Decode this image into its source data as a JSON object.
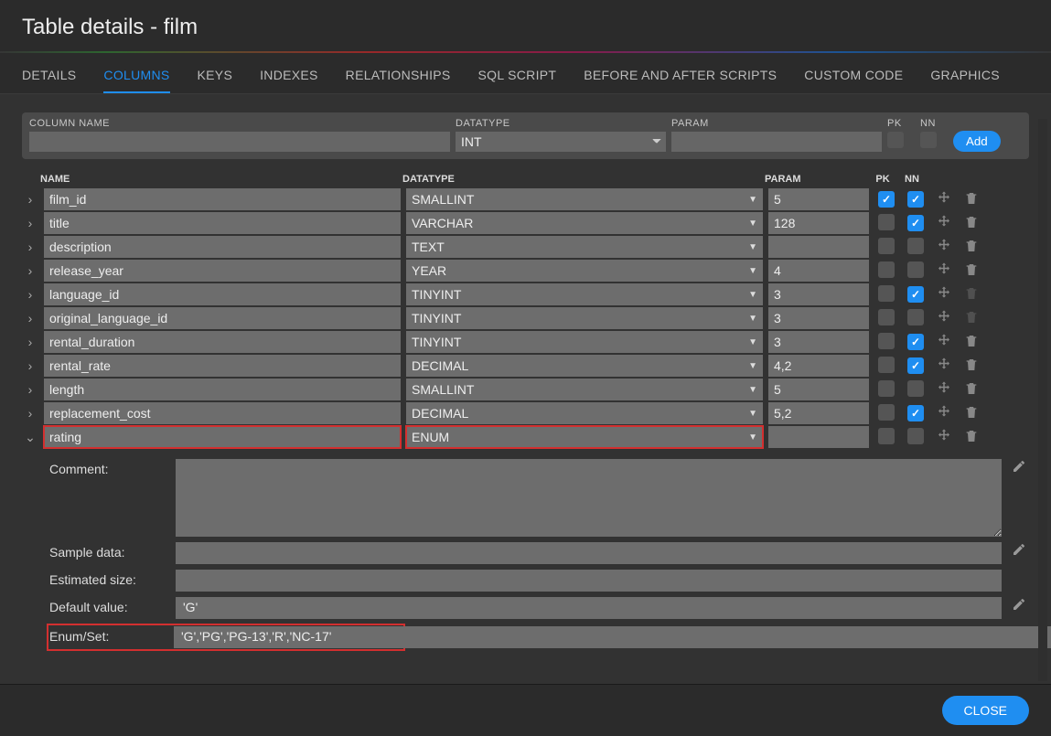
{
  "title": "Table details - film",
  "tabs": [
    "DETAILS",
    "COLUMNS",
    "KEYS",
    "INDEXES",
    "RELATIONSHIPS",
    "SQL SCRIPT",
    "BEFORE AND AFTER SCRIPTS",
    "CUSTOM CODE",
    "GRAPHICS"
  ],
  "activeTab": 1,
  "addRow": {
    "labels": {
      "name": "COLUMN NAME",
      "type": "DATATYPE",
      "param": "PARAM",
      "pk": "PK",
      "nn": "NN"
    },
    "typeValue": "INT",
    "addBtn": "Add"
  },
  "listHeader": {
    "name": "NAME",
    "type": "DATATYPE",
    "param": "PARAM",
    "pk": "PK",
    "nn": "NN"
  },
  "columns": [
    {
      "name": "film_id",
      "type": "SMALLINT",
      "param": "5",
      "pk": true,
      "nn": true,
      "expanded": false,
      "hl": false,
      "deletable": true
    },
    {
      "name": "title",
      "type": "VARCHAR",
      "param": "128",
      "pk": false,
      "nn": true,
      "expanded": false,
      "hl": false,
      "deletable": true
    },
    {
      "name": "description",
      "type": "TEXT",
      "param": "",
      "pk": false,
      "nn": false,
      "expanded": false,
      "hl": false,
      "deletable": true
    },
    {
      "name": "release_year",
      "type": "YEAR",
      "param": "4",
      "pk": false,
      "nn": false,
      "expanded": false,
      "hl": false,
      "deletable": true
    },
    {
      "name": "language_id",
      "type": "TINYINT",
      "param": "3",
      "pk": false,
      "nn": true,
      "expanded": false,
      "hl": false,
      "deletable": false
    },
    {
      "name": "original_language_id",
      "type": "TINYINT",
      "param": "3",
      "pk": false,
      "nn": false,
      "expanded": false,
      "hl": false,
      "deletable": false
    },
    {
      "name": "rental_duration",
      "type": "TINYINT",
      "param": "3",
      "pk": false,
      "nn": true,
      "expanded": false,
      "hl": false,
      "deletable": true
    },
    {
      "name": "rental_rate",
      "type": "DECIMAL",
      "param": "4,2",
      "pk": false,
      "nn": true,
      "expanded": false,
      "hl": false,
      "deletable": true
    },
    {
      "name": "length",
      "type": "SMALLINT",
      "param": "5",
      "pk": false,
      "nn": false,
      "expanded": false,
      "hl": false,
      "deletable": true
    },
    {
      "name": "replacement_cost",
      "type": "DECIMAL",
      "param": "5,2",
      "pk": false,
      "nn": true,
      "expanded": false,
      "hl": false,
      "deletable": true
    },
    {
      "name": "rating",
      "type": "ENUM",
      "param": "",
      "pk": false,
      "nn": false,
      "expanded": true,
      "hl": true,
      "deletable": true
    }
  ],
  "detail": {
    "labels": {
      "comment": "Comment:",
      "sample": "Sample data:",
      "size": "Estimated size:",
      "default": "Default value:",
      "enum": "Enum/Set:"
    },
    "comment": "",
    "sample": "",
    "size": "",
    "default": "'G'",
    "enum": "'G','PG','PG-13','R','NC-17'"
  },
  "closeBtn": "CLOSE"
}
